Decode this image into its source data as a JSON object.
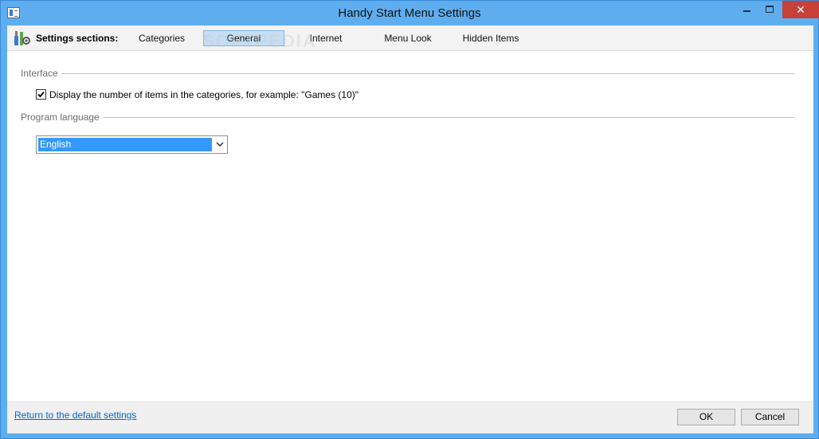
{
  "window": {
    "title": "Handy Start Menu Settings",
    "close_glyph": "✕",
    "accent_color": "#5eaeef"
  },
  "toolbar": {
    "sections_label": "Settings sections:",
    "tabs": [
      {
        "label": "Categories",
        "active": false
      },
      {
        "label": "General",
        "active": true
      },
      {
        "label": "Internet",
        "active": false
      },
      {
        "label": "Menu Look",
        "active": false
      },
      {
        "label": "Hidden Items",
        "active": false
      }
    ],
    "watermark": "SOFTPEDIA"
  },
  "interface_group": {
    "header": "Interface",
    "checkbox_label": "Display the number of items in the categories, for example: \"Games (10)\"",
    "checked": true
  },
  "language_group": {
    "header": "Program language",
    "selected_language": "English"
  },
  "footer": {
    "reset_link": "Return to the default settings",
    "ok_label": "OK",
    "cancel_label": "Cancel"
  },
  "icons": {
    "app": "app-icon",
    "settings": "settings-tools-icon",
    "checkmark": "checkmark-icon",
    "dropdown": "chevron-down-icon"
  }
}
